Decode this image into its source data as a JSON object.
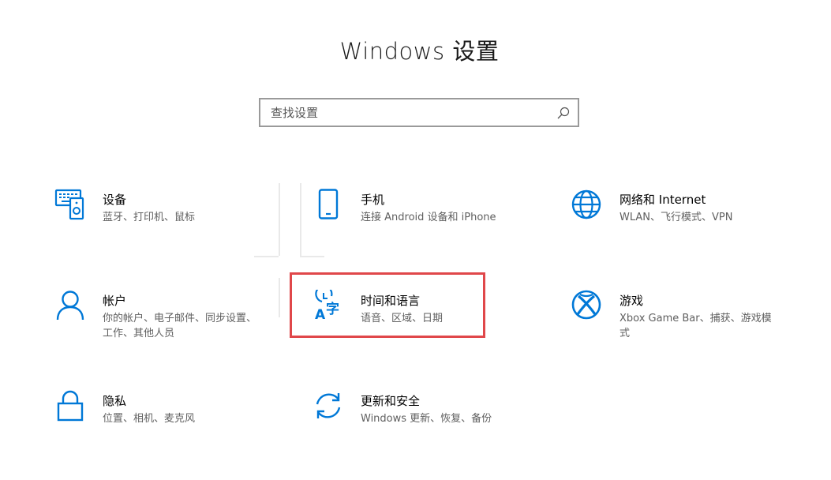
{
  "header": {
    "title": "Windows 设置"
  },
  "search": {
    "placeholder": "查找设置",
    "value": ""
  },
  "colors": {
    "accent": "#0078d7",
    "highlight": "#e0474a",
    "search_border": "#9a9a9a",
    "description": "#5f5f5f"
  },
  "tiles": [
    {
      "icon": "devices-icon",
      "title": "设备",
      "desc": "蓝牙、打印机、鼠标"
    },
    {
      "icon": "phone-icon",
      "title": "手机",
      "desc": "连接 Android 设备和 iPhone"
    },
    {
      "icon": "globe-icon",
      "title": "网络和 Internet",
      "desc": "WLAN、飞行模式、VPN"
    },
    {
      "icon": "person-icon",
      "title": "帐户",
      "desc": "你的帐户、电子邮件、同步设置、工作、其他人员"
    },
    {
      "icon": "time-language-icon",
      "title": "时间和语言",
      "desc": "语音、区域、日期"
    },
    {
      "icon": "xbox-icon",
      "title": "游戏",
      "desc": "Xbox Game Bar、捕获、游戏模式"
    },
    {
      "icon": "lock-icon",
      "title": "隐私",
      "desc": "位置、相机、麦克风"
    },
    {
      "icon": "sync-icon",
      "title": "更新和安全",
      "desc": "Windows 更新、恢复、备份"
    }
  ]
}
